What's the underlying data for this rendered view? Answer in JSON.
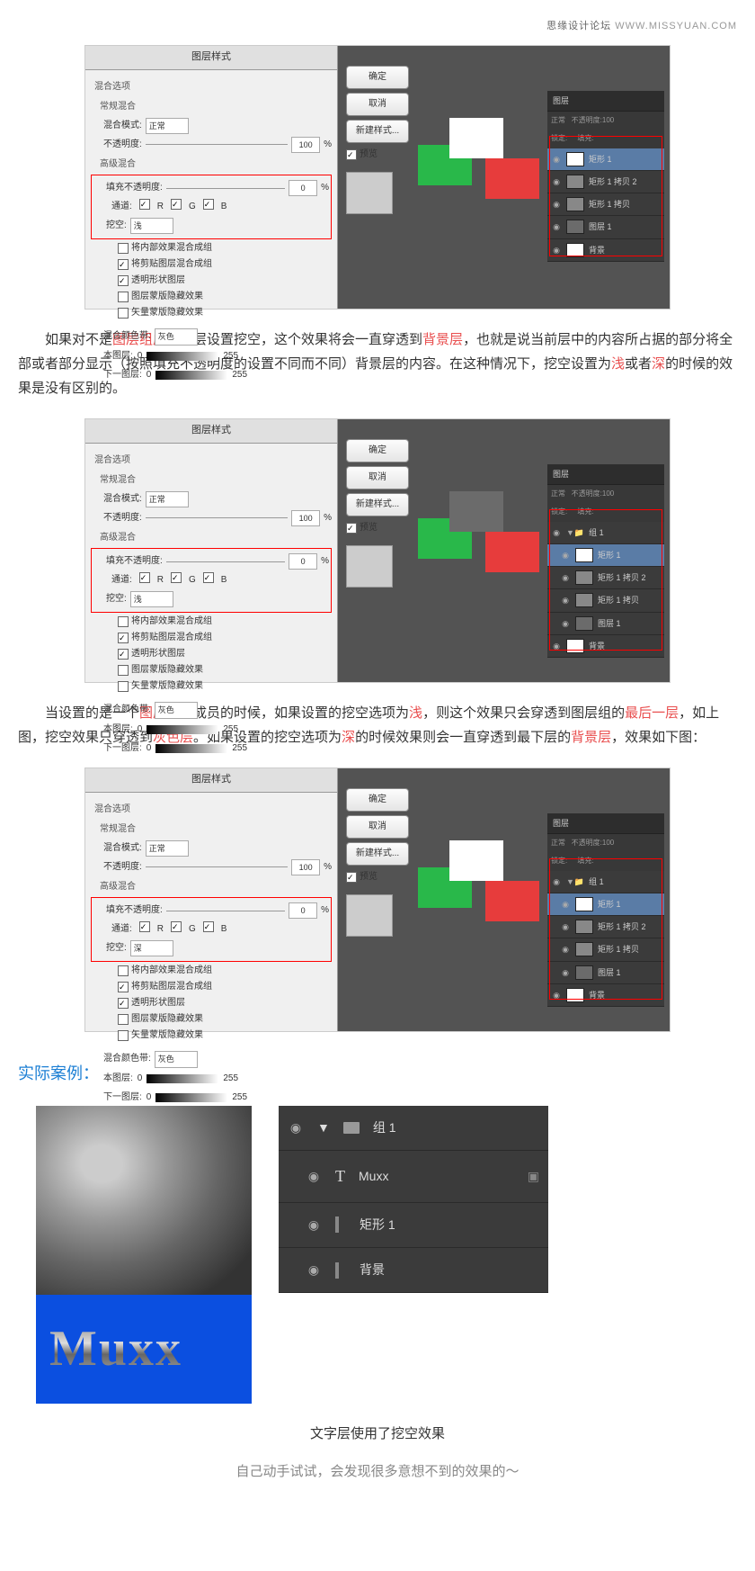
{
  "watermark": {
    "cn": "思缘设计论坛",
    "en": "WWW.MISSYUAN.COM"
  },
  "dialog": {
    "title": "图层样式",
    "sections": {
      "blend": "混合选项",
      "normal": "常规混合",
      "advanced": "高级混合",
      "blendif": "混合颜色带:"
    },
    "labels": {
      "mode": "混合模式:",
      "mode_val": "正常",
      "opacity": "不透明度:",
      "opacity_val": "100",
      "pct": "%",
      "fill": "填充不透明度:",
      "fill_val": "0",
      "channels": "通道:",
      "knockout": "挖空:",
      "knockout_shallow": "浅",
      "knockout_deep": "深",
      "chk1": "将内部效果混合成组",
      "chk2": "将剪贴图层混合成组",
      "chk3": "透明形状图层",
      "chk4": "图层蒙版隐藏效果",
      "chk5": "矢量蒙版隐藏效果",
      "grey": "灰色",
      "this": "本图层:",
      "under": "下一图层:",
      "r0": "0",
      "r255": "255"
    },
    "rgb": {
      "r": "R",
      "g": "G",
      "b": "B"
    },
    "buttons": {
      "ok": "确定",
      "cancel": "取消",
      "newstyle": "新建样式...",
      "preview": "预览"
    }
  },
  "layers_panel": {
    "title": "图层",
    "sub_mode": "正常",
    "sub_op": "不透明度:100",
    "sub_lock": "锁定:",
    "sub_fill": "填充:",
    "group": "组 1",
    "l1": "矩形 1",
    "l2": "矩形 1 拷贝 2",
    "l3": "矩形 1 拷贝",
    "l4": "图层 1",
    "l5": "背景"
  },
  "para1": {
    "t1": "如果对不是",
    "r1": "图层组成员",
    "t2": "的层设置挖空，这个效果将会一直穿透到",
    "r2": "背景层",
    "t3": "，也就是说当前层中的内容所占据的部分将全部或者部分显示（按照填充不透明度的设置不同而不同）背景层的内容。在这种情况下，挖空设置为",
    "r3": "浅",
    "t4": "或者",
    "r4": "深",
    "t5": "的时候的效果是没有区别的。"
  },
  "para2": {
    "t1": "当设置的是一个",
    "r1": "图层组",
    "t2": "内成员的时候，如果设置的挖空选项为",
    "r2": "浅",
    "t3": "，则这个效果只会穿透到图层组的",
    "r3": "最后一层",
    "t4": "，如上图，挖空效果只穿透到",
    "r4": "灰色层",
    "t5": "。如果设置的挖空选项为",
    "r5": "深",
    "t6": "的时候效果则会一直穿透到最下层的",
    "r6": "背景层",
    "t7": "，效果如下图："
  },
  "section_heading": "实际案例：",
  "example": {
    "text": "Muxx",
    "layers": {
      "group": "组 1",
      "l1": "Muxx",
      "l2": "矩形 1",
      "l3": "背景"
    }
  },
  "caption1": "文字层使用了挖空效果",
  "caption2": "自己动手试试，会发现很多意想不到的效果的～"
}
